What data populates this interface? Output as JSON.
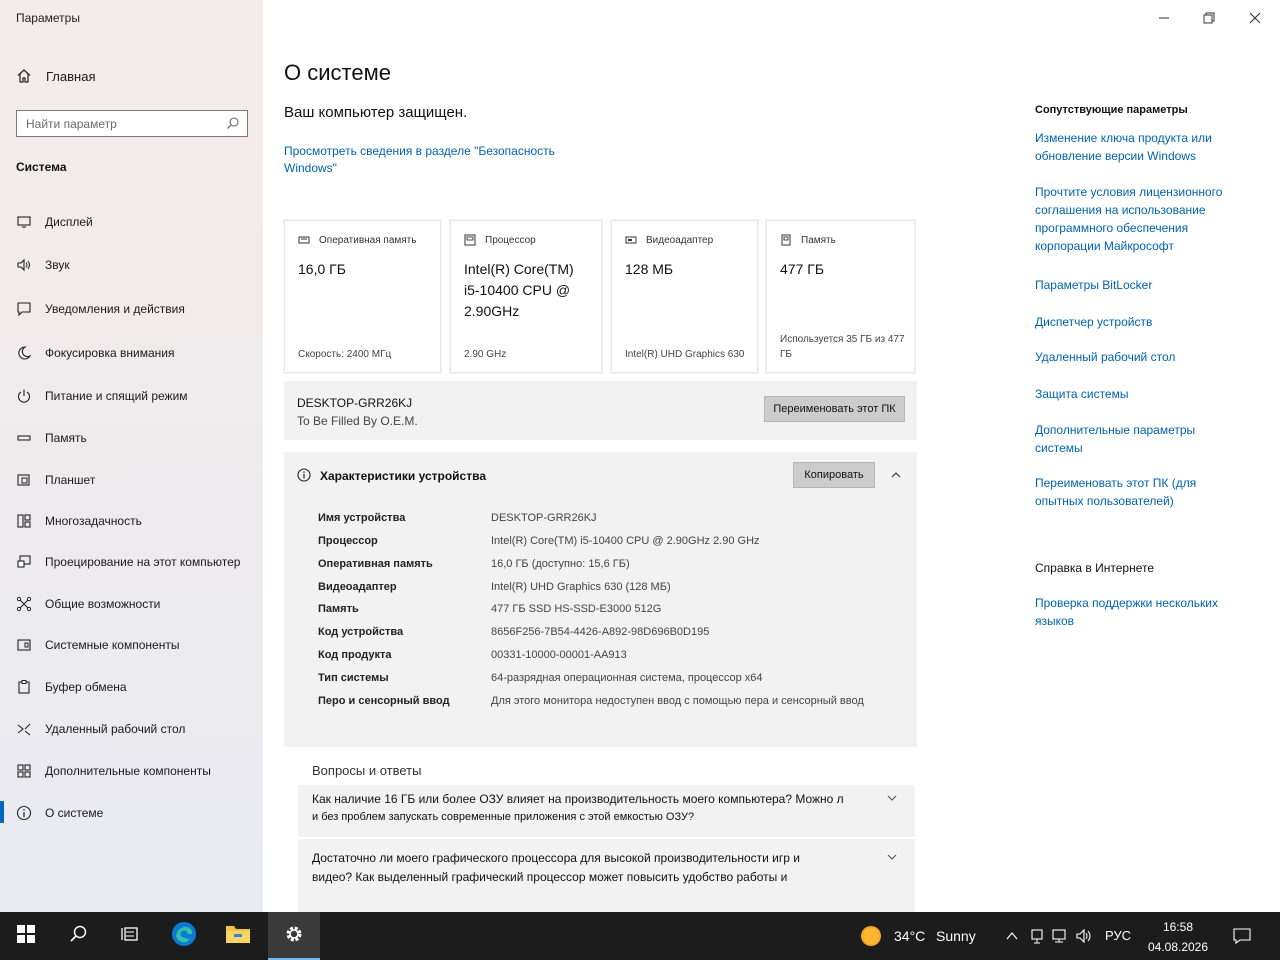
{
  "window": {
    "title": "Параметры"
  },
  "sidebar": {
    "home_label": "Главная",
    "search_placeholder": "Найти параметр",
    "section_label": "Система",
    "items": [
      {
        "label": "Дисплей",
        "icon": "display-icon"
      },
      {
        "label": "Звук",
        "icon": "speaker-icon"
      },
      {
        "label": "Уведомления и действия",
        "icon": "notification-icon"
      },
      {
        "label": "Фокусировка внимания",
        "icon": "moon-icon"
      },
      {
        "label": "Питание и спящий режим",
        "icon": "power-icon"
      },
      {
        "label": "Память",
        "icon": "storage-icon"
      },
      {
        "label": "Планшет",
        "icon": "tablet-icon"
      },
      {
        "label": "Многозадачность",
        "icon": "multitasking-icon"
      },
      {
        "label": "Проецирование на этот компьютер",
        "icon": "projection-icon"
      },
      {
        "label": "Общие возможности",
        "icon": "shared-icon"
      },
      {
        "label": "Системные компоненты",
        "icon": "components-icon"
      },
      {
        "label": "Буфер обмена",
        "icon": "clipboard-icon"
      },
      {
        "label": "Удаленный рабочий стол",
        "icon": "remote-desktop-icon"
      },
      {
        "label": "Дополнительные компоненты",
        "icon": "grid-icon"
      },
      {
        "label": "О системе",
        "icon": "info-icon",
        "active": true
      }
    ]
  },
  "main": {
    "title": "О системе",
    "protected_text": "Ваш компьютер защищен.",
    "security_link": "Просмотреть сведения в разделе \"Безопасность Windows\"",
    "cards": [
      {
        "header": "Оперативная память",
        "value": "16,0 ГБ",
        "footer": "Скорость: 2400 МГц",
        "icon": "ram-icon"
      },
      {
        "header": "Процессор",
        "value": "Intel(R) Core(TM) i5-10400 CPU @ 2.90GHz",
        "footer": "2.90 GHz",
        "icon": "cpu-icon"
      },
      {
        "header": "Видеоадаптер",
        "value": "128 МБ",
        "footer": "Intel(R) UHD Graphics 630",
        "icon": "gpu-icon"
      },
      {
        "header": "Память",
        "value": "477 ГБ",
        "footer": "Используется 35 ГБ из 477 ГБ",
        "icon": "disk-icon"
      }
    ],
    "pc_name": "DESKTOP-GRR26KJ",
    "pc_oem": "To Be Filled By O.E.M.",
    "rename_button": "Переименовать этот ПК",
    "specs": {
      "title": "Характеристики устройства",
      "copy_button": "Копировать",
      "rows": [
        {
          "key": "Имя устройства",
          "value": "DESKTOP-GRR26KJ"
        },
        {
          "key": "Процессор",
          "value": "Intel(R) Core(TM) i5-10400 CPU @ 2.90GHz   2.90 GHz"
        },
        {
          "key": "Оперативная память",
          "value": "16,0 ГБ (доступно: 15,6 ГБ)"
        },
        {
          "key": "Видеоадаптер",
          "value": "Intel(R) UHD Graphics 630 (128 МБ)"
        },
        {
          "key": "Память",
          "value": "477 ГБ SSD HS-SSD-E3000 512G"
        },
        {
          "key": "Код устройства",
          "value": "8656F256-7B54-4426-A892-98D696B0D195"
        },
        {
          "key": "Код продукта",
          "value": "00331-10000-00001-AA913"
        },
        {
          "key": "Тип системы",
          "value": "64-разрядная операционная система, процессор x64"
        },
        {
          "key": "Перо и сенсорный ввод",
          "value": "Для этого монитора недоступен ввод с помощью пера и сенсорный ввод"
        }
      ]
    },
    "faq": {
      "title": "Вопросы и ответы",
      "items": [
        {
          "q1": "Как наличие 16 ГБ или более ОЗУ влияет на производительность моего компьютера? Можно л",
          "q2": "и без проблем запускать современные приложения с этой емкостью ОЗУ?"
        },
        {
          "q1": "Достаточно ли моего графического процессора для высокой производительности игр и",
          "q2": "видео? Как выделенный графический процессор может повысить удобство работы и"
        }
      ]
    }
  },
  "right_panel": {
    "related_heading": "Сопутствующие параметры",
    "related_links": [
      "Изменение ключа продукта или обновление версии Windows",
      "Прочтите условия лицензионного соглашения на использование программного обеспечения корпорации Майкрософт",
      "Параметры BitLocker",
      "Диспетчер устройств",
      "Удаленный рабочий стол",
      "Защита системы",
      "Дополнительные параметры системы",
      "Переименовать этот ПК (для опытных пользователей)"
    ],
    "help_heading": "Справка в Интернете",
    "help_links": [
      "Проверка поддержки нескольких языков"
    ]
  },
  "taskbar": {
    "weather_temp": "34°C",
    "weather_desc": "Sunny",
    "language": "РУС",
    "time": "16:58",
    "date": "04.08.2026",
    "accent": "#76b9ed"
  }
}
